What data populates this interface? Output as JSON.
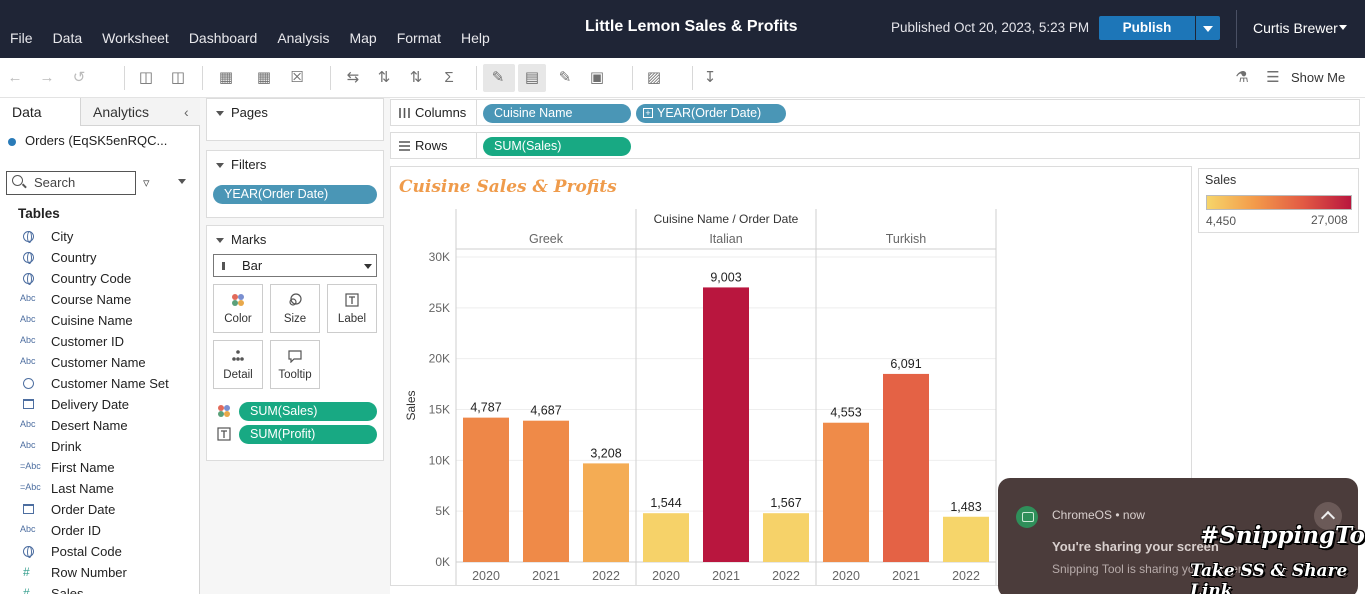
{
  "menu": [
    "File",
    "Data",
    "Worksheet",
    "Dashboard",
    "Analysis",
    "Map",
    "Format",
    "Help"
  ],
  "workbook_title": "Little Lemon Sales & Profits",
  "published": "Published Oct 20, 2023, 5:23 PM",
  "publish_label": "Publish",
  "user_name": "Curtis Brewer",
  "toolbar": {
    "show_me": "Show Me"
  },
  "data_pane": {
    "tab_data": "Data",
    "tab_analytics": "Analytics",
    "data_source": "Orders (EqSK5enRQC...",
    "search_placeholder": "Search",
    "tables_heading": "Tables",
    "fields": [
      {
        "type": "geo",
        "name": "City"
      },
      {
        "type": "geo",
        "name": "Country"
      },
      {
        "type": "geo",
        "name": "Country Code"
      },
      {
        "type": "abc",
        "name": "Course Name"
      },
      {
        "type": "abc",
        "name": "Cuisine Name"
      },
      {
        "type": "abc",
        "name": "Customer ID"
      },
      {
        "type": "abc",
        "name": "Customer Name"
      },
      {
        "type": "set",
        "name": "Customer Name Set"
      },
      {
        "type": "date",
        "name": "Delivery Date"
      },
      {
        "type": "abc",
        "name": "Desert Name"
      },
      {
        "type": "abc",
        "name": "Drink"
      },
      {
        "type": "abc-split",
        "name": "First Name"
      },
      {
        "type": "abc-split",
        "name": "Last Name"
      },
      {
        "type": "date",
        "name": "Order Date"
      },
      {
        "type": "abc",
        "name": "Order ID"
      },
      {
        "type": "geo",
        "name": "Postal Code"
      },
      {
        "type": "num",
        "name": "Row Number"
      },
      {
        "type": "num",
        "name": "Sales"
      }
    ],
    "type_labels": {
      "abc": "Abc",
      "abc-split": "=Abc"
    }
  },
  "pages_card": {
    "title": "Pages"
  },
  "filters_card": {
    "title": "Filters",
    "pill": "YEAR(Order Date)"
  },
  "marks_card": {
    "title": "Marks",
    "mark_type": "Bar",
    "buttons": [
      "Color",
      "Size",
      "Label",
      "Detail",
      "Tooltip"
    ],
    "pills": [
      "SUM(Sales)",
      "SUM(Profit)"
    ]
  },
  "columns_shelf": {
    "label": "Columns",
    "pills": [
      "Cuisine Name",
      "YEAR(Order Date)"
    ]
  },
  "rows_shelf": {
    "label": "Rows",
    "pills": [
      "SUM(Sales)"
    ]
  },
  "chart_data": {
    "type": "bar",
    "title": "Cuisine Sales & Profits",
    "header": "Cuisine Name / Order Date",
    "ylabel": "Sales",
    "ylim": [
      0,
      30000
    ],
    "yticks": [
      0,
      5000,
      10000,
      15000,
      20000,
      25000,
      30000
    ],
    "ytick_labels": [
      "0K",
      "5K",
      "10K",
      "15K",
      "20K",
      "25K",
      "30K"
    ],
    "groups": [
      {
        "name": "Greek",
        "years": [
          "2020",
          "2021",
          "2022"
        ],
        "sales": [
          14200,
          13900,
          9700
        ],
        "profit": [
          "4,787",
          "4,687",
          "3,208"
        ]
      },
      {
        "name": "Italian",
        "years": [
          "2020",
          "2021",
          "2022"
        ],
        "sales": [
          4800,
          27008,
          4800
        ],
        "profit": [
          "1,544",
          "9,003",
          "1,567"
        ]
      },
      {
        "name": "Turkish",
        "years": [
          "2020",
          "2021",
          "2022"
        ],
        "sales": [
          13700,
          18500,
          4450
        ],
        "profit": [
          "4,553",
          "6,091",
          "1,483"
        ]
      }
    ],
    "color_scale": {
      "min": 4450,
      "max": 27008,
      "stops": [
        "#f6d56a",
        "#f39a4a",
        "#e25a44",
        "#b9163e"
      ]
    },
    "grid": true
  },
  "legend": {
    "title": "Sales",
    "min_label": "4,450",
    "max_label": "27,008"
  },
  "notification": {
    "source": "ChromeOS",
    "time": "now",
    "title": "You're sharing your screen",
    "body": "Snipping Tool is sharing your screen"
  },
  "overlay": {
    "tag": "#SnippingTool",
    "sub": "Take SS & Share Link"
  }
}
